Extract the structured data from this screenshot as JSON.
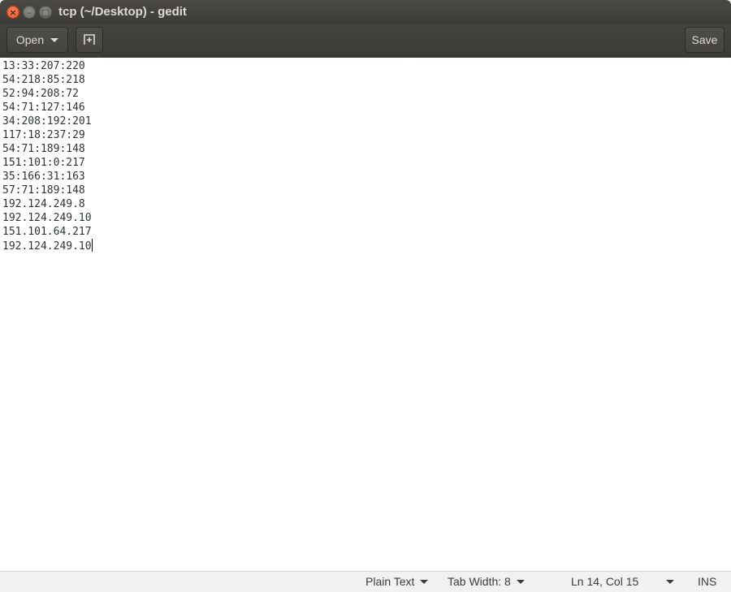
{
  "window": {
    "title": "tcp (~/Desktop) - gedit",
    "controls": {
      "close_glyph": "×",
      "minimize_glyph": "–",
      "maximize_glyph": "□"
    }
  },
  "headerbar": {
    "open_label": "Open",
    "new_tab_icon": "new-document-icon",
    "save_label": "Save"
  },
  "editor": {
    "lines": [
      "13:33:207:220",
      "54:218:85:218",
      "52:94:208:72",
      "54:71:127:146",
      "34:208:192:201",
      "117:18:237:29",
      "54:71:189:148",
      "151:101:0:217",
      "35:166:31:163",
      "57:71:189:148",
      "192.124.249.8",
      "192.124.249.10",
      "151.101.64.217",
      "192.124.249.10"
    ]
  },
  "statusbar": {
    "language": "Plain Text",
    "tab_width": "Tab Width: 8",
    "position": "Ln 14, Col 15",
    "mode": "INS"
  },
  "colors": {
    "titlebar": "#3c3b37",
    "close_button": "#e95420",
    "editor_text": "#2e3436",
    "statusbar_bg": "#f2f1f0"
  }
}
